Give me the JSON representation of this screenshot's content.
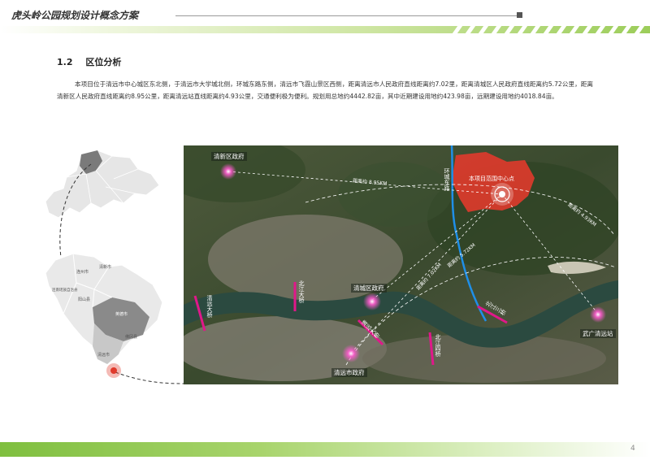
{
  "header": {
    "title": "虎头岭公园规划设计概念方案"
  },
  "section": {
    "number": "1.2",
    "title": "区位分析"
  },
  "body_text": "本项目位于清远市中心城区东北侧，于清远市大学城北侧，环城东路东侧，清远市飞霞山景区西侧，距离清远市人民政府直线距离约7.02里，距离清城区人民政府直线距离约5.72公里，距离清新区人民政府直线距离约8.95公里，距离清远站直线距离约4.93公里，交通便利极为便利。规划用总地约4442.82亩，其中近期建设用地约423.98亩，远期建设用地约4018.84亩。",
  "left_map": {
    "labels": [
      "清新市",
      "英德市",
      "连州市",
      "连南瑶族自治县",
      "阳山县",
      "英德市",
      "佛冈县",
      "清远市"
    ]
  },
  "sat_map": {
    "labels": {
      "qingxin_gov": "清新区政府",
      "qingcheng_gov": "清城区政府",
      "qingyuan_gov": "清远市政府",
      "project_center": "本项目范围中心点",
      "wuguang_station": "武广清远站",
      "huancheng_road": "环城东路",
      "beijiang_bridge": "北江大桥",
      "beijiang_4_bridge": "北江四桥",
      "bridge_left": "清远大桥",
      "bridge_right": "北江三桥",
      "bridge_mid": "清远大桥"
    },
    "distances": {
      "qingxin": "距离约 8.95KM",
      "qingcheng": "距离约 5.72KM",
      "qingyuan": "距离约 7.02KM",
      "station": "距离约 4.93KM"
    }
  },
  "footer": {
    "page_number": "4"
  },
  "colors": {
    "accent_green": "#8cc34a",
    "project_red": "#e03a2c",
    "marker_pink": "#ff4fc4"
  }
}
